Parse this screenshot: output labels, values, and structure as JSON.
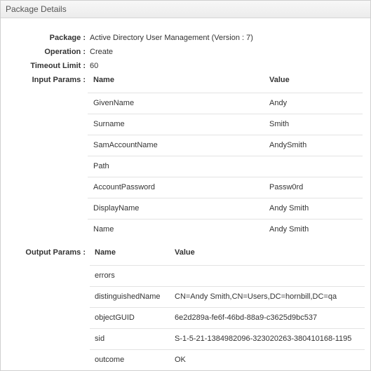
{
  "panel": {
    "title": "Package Details"
  },
  "fields": {
    "package": {
      "label": "Package :",
      "value": "Active Directory User Management (Version : 7)"
    },
    "operation": {
      "label": "Operation :",
      "value": "Create"
    },
    "timeout": {
      "label": "Timeout Limit :",
      "value": "60"
    }
  },
  "input_params": {
    "label": "Input Params :",
    "headers": {
      "name": "Name",
      "value": "Value"
    },
    "rows": [
      {
        "name": "GivenName",
        "value": "Andy"
      },
      {
        "name": "Surname",
        "value": "Smith"
      },
      {
        "name": "SamAccountName",
        "value": "AndySmith"
      },
      {
        "name": "Path",
        "value": ""
      },
      {
        "name": "AccountPassword",
        "value": "Passw0rd"
      },
      {
        "name": "DisplayName",
        "value": "Andy Smith"
      },
      {
        "name": "Name",
        "value": "Andy Smith"
      }
    ]
  },
  "output_params": {
    "label": "Output Params :",
    "headers": {
      "name": "Name",
      "value": "Value"
    },
    "rows": [
      {
        "name": "errors",
        "value": ""
      },
      {
        "name": "distinguishedName",
        "value": "CN=Andy Smith,CN=Users,DC=hornbill,DC=qa"
      },
      {
        "name": "objectGUID",
        "value": "6e2d289a-fe6f-46bd-88a9-c3625d9bc537"
      },
      {
        "name": "sid",
        "value": "S-1-5-21-1384982096-323020263-380410168-1195"
      },
      {
        "name": "outcome",
        "value": "OK"
      }
    ]
  }
}
